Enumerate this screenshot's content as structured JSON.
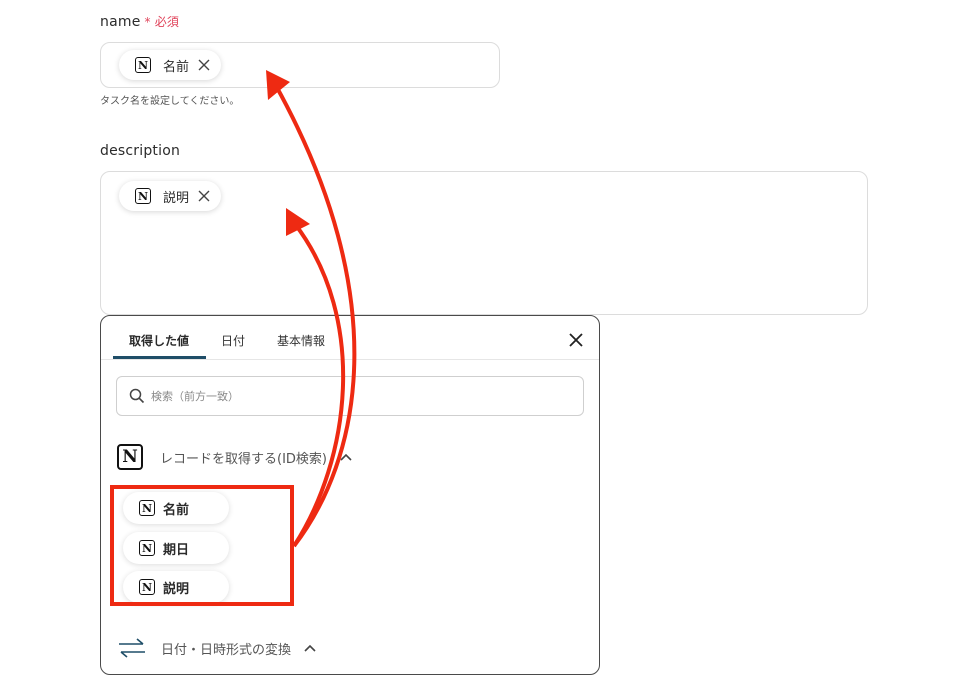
{
  "form": {
    "name_label": "name",
    "required_mark": "*",
    "required_text": "必須",
    "name_chip": "名前",
    "name_hint": "タスク名を設定してください。",
    "description_label": "description",
    "description_chip": "説明"
  },
  "panel": {
    "tabs": [
      {
        "label": "取得した値",
        "active": true
      },
      {
        "label": "日付",
        "active": false
      },
      {
        "label": "基本情報",
        "active": false
      }
    ],
    "search_placeholder": "検索（前方一致）",
    "section1_title": "レコードを取得する(ID検索)",
    "items": [
      "名前",
      "期日",
      "説明"
    ],
    "section2_title": "日付・日時形式の変換"
  },
  "icons": {
    "notion": "notion-logo-icon",
    "close": "close-icon",
    "search": "search-icon",
    "chevron": "chevron-up-icon",
    "convert": "convert-arrows-icon"
  },
  "colors": {
    "required": "#e0445b",
    "tab_underline": "#1f4e68",
    "annotation": "#ee2a12"
  }
}
